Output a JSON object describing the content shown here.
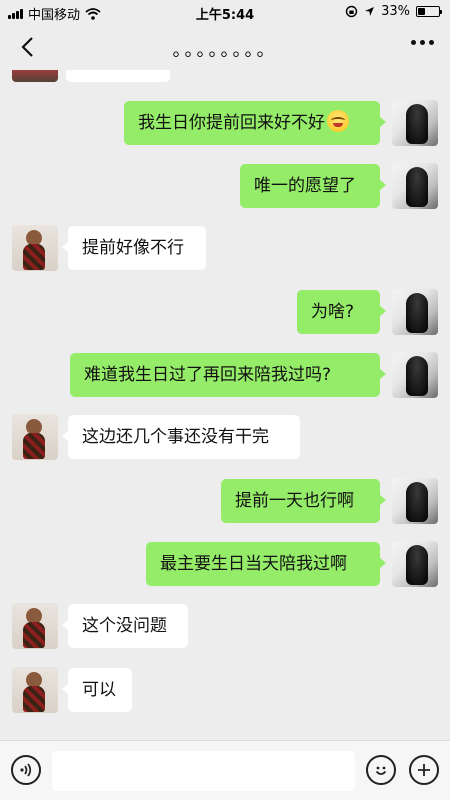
{
  "status_bar": {
    "carrier": "中国移动",
    "time": "上午5:44",
    "battery": "33%",
    "battery_level": 0.33
  },
  "nav": {
    "title": "。。。。。。。。"
  },
  "messages": [
    {
      "from": "me",
      "text": "我生日你提前回来好不好",
      "emoji": "grinning-face-emoji"
    },
    {
      "from": "me",
      "text": "唯一的愿望了"
    },
    {
      "from": "other",
      "text": "提前好像不行"
    },
    {
      "from": "me",
      "text": "为啥?"
    },
    {
      "from": "me",
      "text": "难道我生日过了再回来陪我过吗?"
    },
    {
      "from": "other",
      "text": "这边还几个事还没有干完"
    },
    {
      "from": "me",
      "text": "提前一天也行啊"
    },
    {
      "from": "me",
      "text": "最主要生日当天陪我过啊"
    },
    {
      "from": "other",
      "text": "这个没问题"
    },
    {
      "from": "other",
      "text": "可以"
    }
  ],
  "input_bar": {
    "voice_icon": "voice-icon",
    "emoji_icon": "smiley-icon",
    "more_icon": "plus-icon",
    "placeholder": ""
  },
  "colors": {
    "background": "#ededed",
    "outgoing_bubble": "#95ec69",
    "incoming_bubble": "#ffffff"
  }
}
